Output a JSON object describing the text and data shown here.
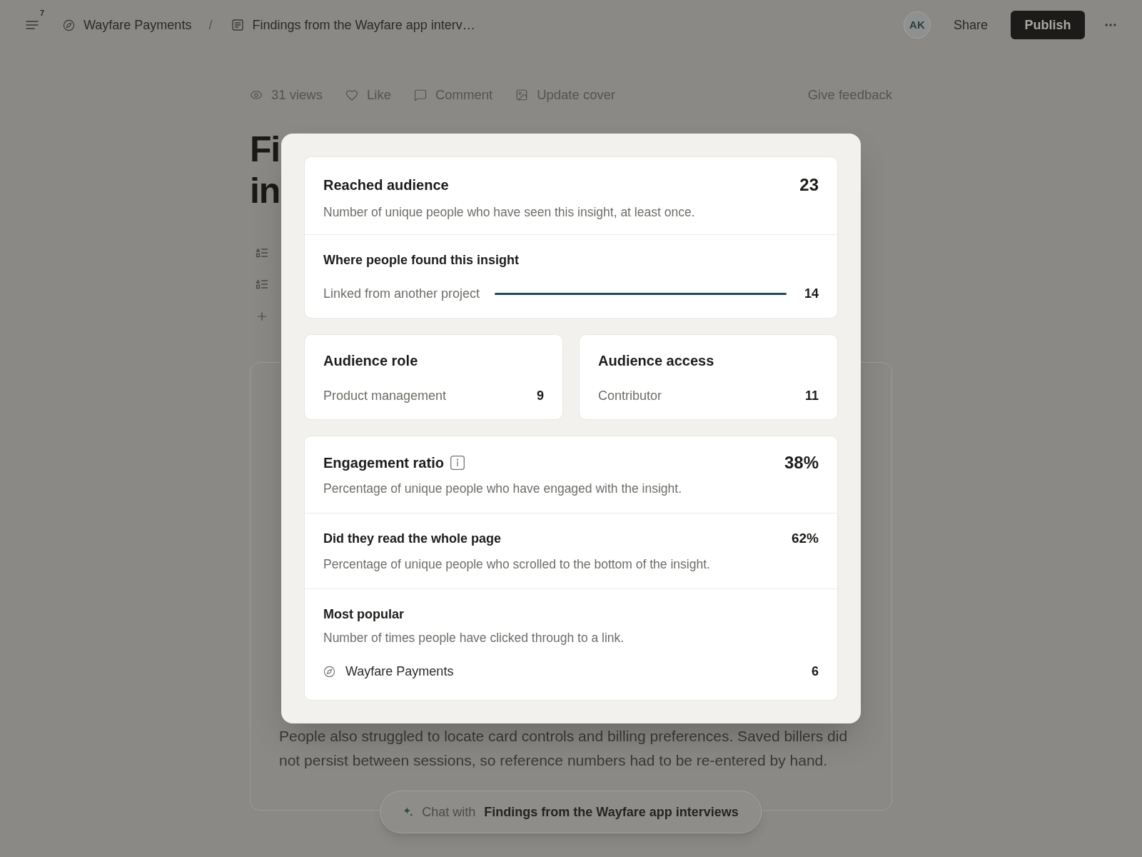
{
  "top_bar": {
    "menu_count": "7",
    "breadcrumbs": [
      {
        "kind": "space",
        "label": "Wayfare Payments"
      },
      {
        "kind": "page",
        "label": "Findings from the Wayfare app interv…"
      }
    ],
    "separator": "/",
    "avatar": "AK",
    "share": "Share",
    "publish": "Publish"
  },
  "page": {
    "actions": [
      {
        "kind": "views",
        "label": "31 views"
      },
      {
        "kind": "like",
        "label": "Like"
      },
      {
        "kind": "comment",
        "label": "Comment"
      },
      {
        "kind": "cover",
        "label": "Update cover"
      }
    ],
    "feedback": "Give feedback",
    "title_lines": [
      "Fi",
      "in"
    ],
    "paragraph": "People also struggled to locate card controls and billing preferences. Saved billers did not persist between sessions, so reference numbers had to be re-entered by hand.",
    "chat": {
      "prefix": "Chat with",
      "title": "Findings from the Wayfare app interviews"
    }
  },
  "modal": {
    "reach": {
      "title": "Reached audience",
      "value": "23",
      "description": "Number of unique people who have seen this insight, at least once."
    },
    "sources": {
      "title": "Where people found this insight",
      "rows": [
        {
          "label": "Linked from another project",
          "value": "14",
          "level": 1
        }
      ]
    },
    "role": {
      "title": "Audience role",
      "rows": [
        {
          "label": "Product management",
          "value": "9"
        }
      ]
    },
    "access": {
      "title": "Audience access",
      "rows": [
        {
          "label": "Contributor",
          "value": "11"
        }
      ]
    },
    "engagement": {
      "title": "Engagement ratio",
      "info": true,
      "value": "38%",
      "description": "Percentage of unique people who have engaged with the insight."
    },
    "read": {
      "title": "Did they read the whole page",
      "value": "62%",
      "description": "Percentage of unique people who scrolled to the bottom of the insight."
    },
    "popular": {
      "title": "Most popular",
      "description": "Number of times people have clicked through to a link.",
      "links": [
        {
          "kind": "space",
          "label": "Wayfare Payments",
          "value": "6"
        }
      ]
    }
  }
}
